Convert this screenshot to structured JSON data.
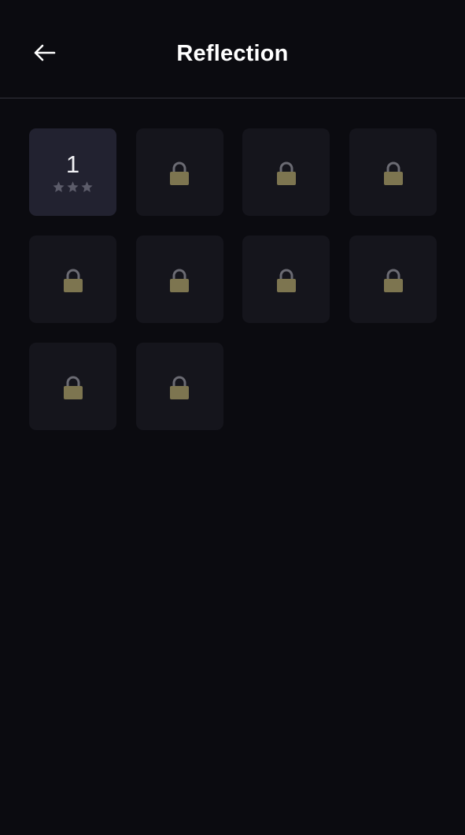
{
  "header": {
    "title": "Reflection",
    "back_icon": "arrow-left-icon"
  },
  "levels": [
    {
      "label": "1",
      "locked": false,
      "stars_earned": 0,
      "stars_total": 3
    },
    {
      "label": "",
      "locked": true,
      "icon": "lock-icon"
    },
    {
      "label": "",
      "locked": true,
      "icon": "lock-icon"
    },
    {
      "label": "",
      "locked": true,
      "icon": "lock-icon"
    },
    {
      "label": "",
      "locked": true,
      "icon": "lock-icon"
    },
    {
      "label": "",
      "locked": true,
      "icon": "lock-icon"
    },
    {
      "label": "",
      "locked": true,
      "icon": "lock-icon"
    },
    {
      "label": "",
      "locked": true,
      "icon": "lock-icon"
    },
    {
      "label": "",
      "locked": true,
      "icon": "lock-icon"
    },
    {
      "label": "",
      "locked": true,
      "icon": "lock-icon"
    }
  ],
  "colors": {
    "background": "#0b0b10",
    "tile_unlocked": "#222230",
    "tile_locked": "#15151c",
    "star_empty": "#5c5c6a",
    "lock_body": "#7d7550",
    "lock_shackle": "#6b6b73"
  }
}
